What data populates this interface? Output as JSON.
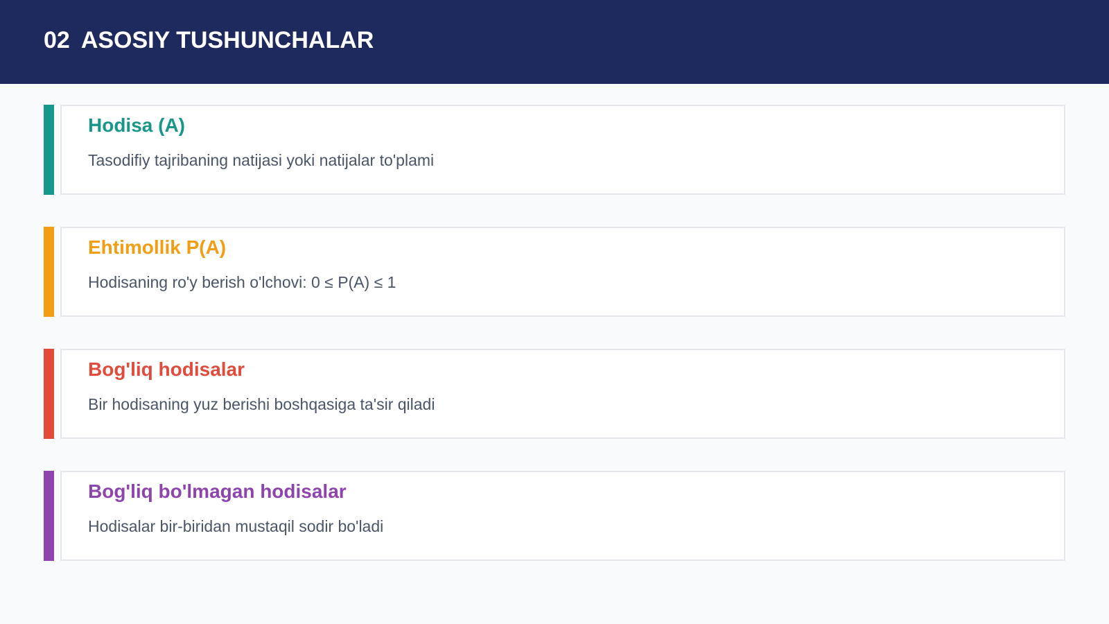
{
  "header": {
    "number": "02",
    "title": "ASOSIY TUSHUNCHALAR",
    "background": "#1e2a5e"
  },
  "concepts": [
    {
      "title": "Hodisa (A)",
      "description": "Tasodifiy tajribaning natijasi yoki natijalar to'plami",
      "color": "#17978a"
    },
    {
      "title": "Ehtimollik P(A)",
      "description": "Hodisaning ro'y berish o'lchovi: 0 ≤ P(A) ≤ 1",
      "color": "#f29d12"
    },
    {
      "title": "Bog'liq hodisalar",
      "description": "Bir hodisaning yuz berishi boshqasiga ta'sir qiladi",
      "color": "#e24b3b"
    },
    {
      "title": "Bog'liq bo'lmagan hodisalar",
      "description": "Hodisalar bir-biridan mustaqil sodir bo'ladi",
      "color": "#8e44ad"
    }
  ]
}
